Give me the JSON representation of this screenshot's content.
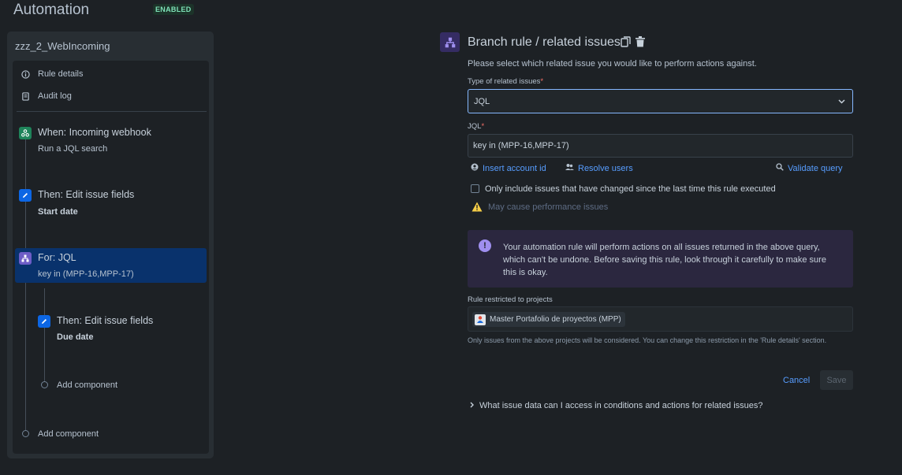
{
  "header": {
    "title": "Automation",
    "status_badge": "ENABLED"
  },
  "rule": {
    "name": "zzz_2_WebIncoming",
    "menu": [
      {
        "label": "Rule details",
        "icon": "info-icon"
      },
      {
        "label": "Audit log",
        "icon": "audit-log-icon"
      }
    ],
    "steps": {
      "trigger": {
        "title": "When: Incoming webhook",
        "subtitle": "Run a JQL search",
        "icon": "webhook-icon",
        "color": "#1f845a"
      },
      "action1": {
        "title": "Then: Edit issue fields",
        "subtitle": "Start date",
        "icon": "pencil-icon",
        "color": "#0c66e4"
      },
      "branch": {
        "title": "For: JQL",
        "subtitle": "key in (MPP-16,MPP-17)",
        "icon": "branch-icon",
        "color": "#6e5dc6"
      },
      "action2": {
        "title": "Then: Edit issue fields",
        "subtitle": "Due date",
        "icon": "pencil-icon",
        "color": "#0c66e4"
      },
      "add_component_inner": "Add component",
      "add_component_outer": "Add component"
    }
  },
  "form": {
    "title": "Branch rule / related issues",
    "description": "Please select which related issue you would like to perform actions against.",
    "related_type": {
      "label": "Type of related issues",
      "required_mark": "*",
      "value": "JQL"
    },
    "jql": {
      "label": "JQL",
      "required_mark": "*",
      "value": "key in (MPP-16,MPP-17)"
    },
    "links": {
      "insert_account": "Insert account id",
      "resolve_users": "Resolve users",
      "validate": "Validate query"
    },
    "only_changed": {
      "label": "Only include issues that have changed since the last time this rule executed",
      "checked": false
    },
    "performance_warning": "May cause performance issues",
    "info_message": "Your automation rule will perform actions on all issues returned in the above query, which can't be undone. Before saving this rule, look through it carefully to make sure this is okay.",
    "projects": {
      "label": "Rule restricted to projects",
      "chips": [
        "Master Portafolio de proyectos (MPP)"
      ],
      "help": "Only issues from the above projects will be considered. You can change this restriction in the 'Rule details' section."
    },
    "buttons": {
      "cancel": "Cancel",
      "save": "Save"
    },
    "faq": "What issue data can I access in conditions and actions for related issues?"
  },
  "colors": {
    "accent_link": "#579dff",
    "focus_border": "#85b8ff",
    "selected_step": "#09326c",
    "warning": "#f5cd47",
    "info_panel": "#2b273f"
  }
}
